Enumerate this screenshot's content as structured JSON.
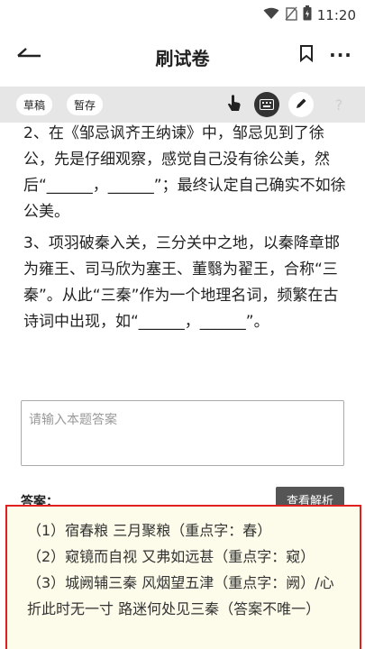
{
  "status_bar": {
    "time": "11:20",
    "icons": [
      "wifi-icon",
      "sim-icon",
      "battery-icon"
    ]
  },
  "app_bar": {
    "title": "刷试卷",
    "more_label": "···",
    "icons": [
      "back-arrow-icon",
      "bookmark-icon"
    ]
  },
  "toolbar": {
    "draft_label": "草稿",
    "save_label": "暂存",
    "help_label": "?",
    "icons": [
      "hand-pointer-icon",
      "keyboard-icon",
      "pen-icon"
    ]
  },
  "questions": [
    {
      "text": "2、在《邹忌讽齐王纳谏》中，邹忌见到了徐公，先是仔细观察，感觉自己没有徐公美，然后“______，______”；最终认定自己确实不如徐公美。"
    },
    {
      "text": "3、项羽破秦入关，三分关中之地，以秦降章邯为雍王、司马欣为塞王、董翳为翟王，合称“三秦”。从此“三秦”作为一个地理名词，频繁在古诗词中出现，如“______，______”。"
    }
  ],
  "answer_input": {
    "placeholder": "请输入本题答案"
  },
  "answer": {
    "label": "答案：",
    "analysis_button": "查看解析",
    "lines": [
      "（1）宿春粮 三月聚粮（重点字：春）",
      "（2）窥镜而自视 又弗如远甚（重点字：窥）",
      "（3）城阙辅三秦 风烟望五津（重点字：阙）/心折此时无一寸 路迷何处见三秦（答案不唯一）"
    ]
  },
  "colors": {
    "toolbar_bg": "#e6e6e6",
    "highlight_border": "#e02020",
    "answer_bg": "#fdfcea",
    "analysis_button_bg": "#555555"
  }
}
